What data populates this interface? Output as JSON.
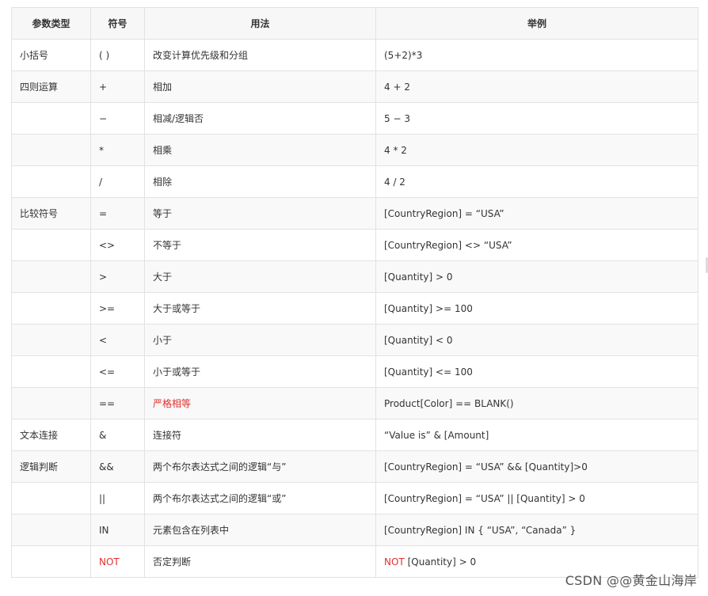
{
  "table": {
    "headers": [
      "参数类型",
      "符号",
      "用法",
      "举例"
    ],
    "rows": [
      {
        "category": "小括号",
        "symbol": "( )",
        "usage": "改变计算优先级和分组",
        "example_prefix": "",
        "example": "(5+2)*3",
        "highlight": false
      },
      {
        "category": "四则运算",
        "symbol": "+",
        "usage": "相加",
        "example_prefix": "",
        "example": "4 + 2",
        "highlight": false
      },
      {
        "category": "",
        "symbol": "−",
        "usage": "相减/逻辑否",
        "example_prefix": "",
        "example": "5 − 3",
        "highlight": false
      },
      {
        "category": "",
        "symbol": "*",
        "usage": "相乘",
        "example_prefix": "",
        "example": "4 * 2",
        "highlight": false
      },
      {
        "category": "",
        "symbol": "/",
        "usage": "相除",
        "example_prefix": "",
        "example": "4 / 2",
        "highlight": false
      },
      {
        "category": "比较符号",
        "symbol": "=",
        "usage": "等于",
        "example_prefix": "",
        "example": "[CountryRegion] = “USA”",
        "highlight": false
      },
      {
        "category": "",
        "symbol": "<>",
        "usage": "不等于",
        "example_prefix": "",
        "example": "[CountryRegion] <> “USA”",
        "highlight": false
      },
      {
        "category": "",
        "symbol": ">",
        "usage": "大于",
        "example_prefix": "",
        "example": "[Quantity] > 0",
        "highlight": false
      },
      {
        "category": "",
        "symbol": ">=",
        "usage": "大于或等于",
        "example_prefix": "",
        "example": "[Quantity] >= 100",
        "highlight": false
      },
      {
        "category": "",
        "symbol": "<",
        "usage": "小于",
        "example_prefix": "",
        "example": "[Quantity] < 0",
        "highlight": false
      },
      {
        "category": "",
        "symbol": "<=",
        "usage": "小于或等于",
        "example_prefix": "",
        "example": "[Quantity] <= 100",
        "highlight": false
      },
      {
        "category": "",
        "symbol": "==",
        "usage": "严格相等",
        "example_prefix": "",
        "example": "Product[Color] == BLANK()",
        "highlight": "usage"
      },
      {
        "category": "文本连接",
        "symbol": "&",
        "usage": "连接符",
        "example_prefix": "",
        "example": "“Value is” & [Amount]",
        "highlight": false
      },
      {
        "category": "逻辑判断",
        "symbol": "&&",
        "usage": "两个布尔表达式之间的逻辑“与”",
        "example_prefix": "",
        "example": "[CountryRegion] = “USA” && [Quantity]>0",
        "highlight": false
      },
      {
        "category": "",
        "symbol": "||",
        "usage": "两个布尔表达式之间的逻辑“或”",
        "example_prefix": "",
        "example": "[CountryRegion] = “USA” || [Quantity] > 0",
        "highlight": false
      },
      {
        "category": "",
        "symbol": "IN",
        "usage": "元素包含在列表中",
        "example_prefix": "",
        "example": "[CountryRegion] IN { “USA”, “Canada” }",
        "highlight": false
      },
      {
        "category": "",
        "symbol": "NOT",
        "usage": "否定判断",
        "example_prefix": "NOT",
        "example": " [Quantity] > 0",
        "highlight": "symbol"
      }
    ]
  },
  "watermark": "CSDN @@黄金山海岸",
  "colors": {
    "highlight": "#e03131",
    "border": "#e2e2e2",
    "header_bg": "#f7f7f7"
  }
}
